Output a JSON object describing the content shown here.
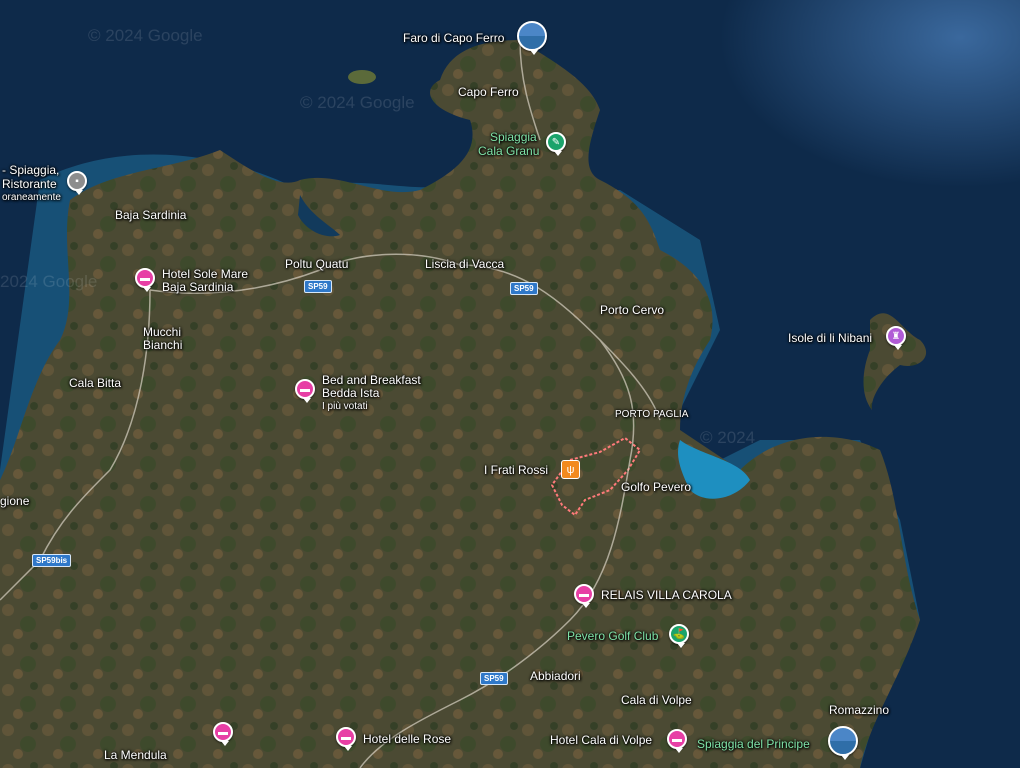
{
  "map": {
    "watermarks": [
      "© 2024 Google",
      "© 2024 Google",
      "2024 Google",
      "© 2024"
    ],
    "road_shields": [
      "SP59",
      "SP59",
      "SP59",
      "SP59bis"
    ],
    "places": {
      "faro": "Faro di Capo Ferro",
      "capo_ferro": "Capo Ferro",
      "spiaggia_cala_granu_1": "Spiaggia",
      "spiaggia_cala_granu_2": "Cala Granu",
      "spiaggia_ristorante_1": "- Spiaggia,",
      "spiaggia_ristorante_2": "Ristorante",
      "spiaggia_ristorante_3": "oraneamente",
      "baja_sardinia": "Baja Sardinia",
      "hotel_sole_mare_1": "Hotel Sole Mare",
      "hotel_sole_mare_2": "Baja Sardinia",
      "poltu_quatu": "Poltu Quatu",
      "liscia_di_vacca": "Liscia di Vacca",
      "porto_cervo": "Porto Cervo",
      "isole_nibani": "Isole di li Nibani",
      "mucchi_bianchi_1": "Mucchi",
      "mucchi_bianchi_2": "Bianchi",
      "cala_bitta": "Cala Bitta",
      "bnb_1": "Bed and Breakfast",
      "bnb_2": "Bedda Ista",
      "bnb_3": "I più votati",
      "porto_paglia": "PORTO PAGLIA",
      "frati_rossi": "I Frati Rossi",
      "golfo_pevero": "Golfo Pevero",
      "gione": "gione",
      "relais": "RELAIS VILLA CAROLA",
      "pevero_golf": "Pevero Golf Club",
      "abbiadori": "Abbiadori",
      "cala_di_volpe": "Cala di Volpe",
      "romazzino": "Romazzino",
      "la_mendula": "La Mendula",
      "hotel_delle_rose": "Hotel delle Rose",
      "hotel_cala_di_volpe": "Hotel Cala di Volpe",
      "spiaggia_principe": "Spiaggia del Principe"
    },
    "colors": {
      "sea_deep": "#0e2a4a",
      "sea_shallow": "#1f7fa8",
      "land": "#4a4a30",
      "hotel": "#e73fa5",
      "beach": "#1ba36b",
      "food": "#f28a1e"
    }
  }
}
